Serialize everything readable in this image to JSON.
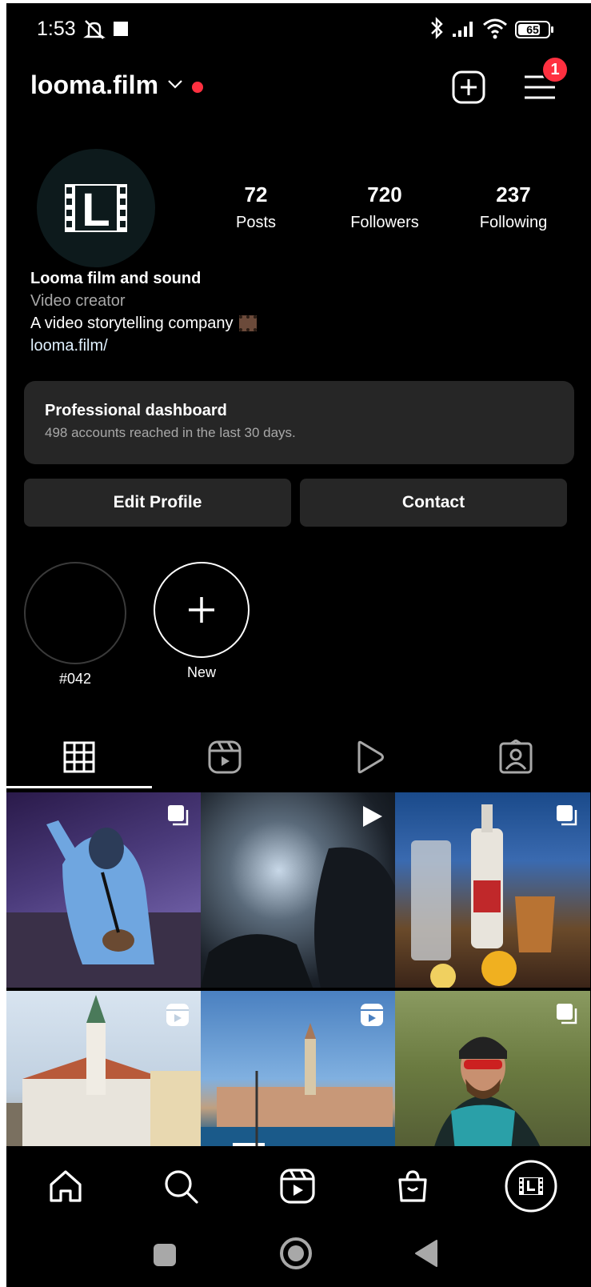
{
  "status_bar": {
    "time": "1:53",
    "battery": "65",
    "icons": [
      "mute-icon",
      "notification-square-icon",
      "bluetooth-icon",
      "signal-icon",
      "wifi-icon",
      "battery-icon"
    ]
  },
  "header": {
    "username": "looma.film",
    "notification_count": "1",
    "accent_color": "#ff3040"
  },
  "profile": {
    "avatar_letter": "L",
    "stats": [
      {
        "value": "72",
        "label": "Posts"
      },
      {
        "value": "720",
        "label": "Followers"
      },
      {
        "value": "237",
        "label": "Following"
      }
    ],
    "name": "Looma film and sound",
    "category": "Video creator",
    "bio": "A video storytelling company",
    "link": "looma.film/"
  },
  "dashboard": {
    "title": "Professional dashboard",
    "subtitle": "498 accounts reached in the last 30 days."
  },
  "actions": {
    "edit_profile": "Edit Profile",
    "contact": "Contact"
  },
  "highlights": [
    {
      "label": "#042"
    },
    {
      "label": "New"
    }
  ],
  "tabs": [
    "grid-icon",
    "reels-icon",
    "play-icon",
    "tagged-icon"
  ],
  "grid": [
    {
      "subject": "person in blue hoodie",
      "badge": "carousel-icon"
    },
    {
      "subject": "camera operator silhouette",
      "badge": "play-icon"
    },
    {
      "subject": "bar cocktail bottles",
      "badge": "carousel-icon"
    },
    {
      "subject": "town square with church",
      "badge": "reels-icon"
    },
    {
      "subject": "coastal old town",
      "badge": "reels-icon"
    },
    {
      "subject": "cyclist with helmet",
      "badge": "carousel-icon"
    }
  ],
  "bottom_nav": [
    "home-icon",
    "search-icon",
    "reels-icon",
    "shop-icon",
    "profile-icon"
  ]
}
